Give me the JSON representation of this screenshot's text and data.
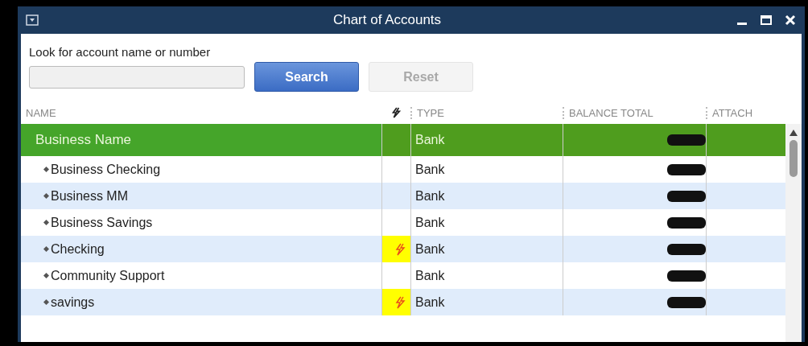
{
  "window": {
    "title": "Chart of Accounts"
  },
  "search": {
    "label": "Look for account name or number",
    "search_button": "Search",
    "reset_button": "Reset",
    "reset_disabled": true
  },
  "columns": {
    "name": "NAME",
    "type": "TYPE",
    "balance": "BALANCE TOTAL",
    "attach": "ATTACH"
  },
  "accounts": [
    {
      "name": "Business Name",
      "selected": true,
      "online": false,
      "highlighted": false,
      "type": "Bank",
      "balance_redacted": true,
      "children": [
        {
          "name": "Business Checking",
          "selected": false,
          "online": false,
          "highlighted": false,
          "type": "Bank",
          "balance_redacted": true
        },
        {
          "name": "Business MM",
          "selected": false,
          "online": false,
          "highlighted": false,
          "type": "Bank",
          "balance_redacted": true
        },
        {
          "name": "Business Savings",
          "selected": false,
          "online": false,
          "highlighted": false,
          "type": "Bank",
          "balance_redacted": true
        },
        {
          "name": "Checking",
          "selected": false,
          "online": true,
          "highlighted": true,
          "type": "Bank",
          "balance_redacted": true
        },
        {
          "name": "Community Support",
          "selected": false,
          "online": false,
          "highlighted": false,
          "type": "Bank",
          "balance_redacted": true
        },
        {
          "name": "savings",
          "selected": false,
          "online": true,
          "highlighted": true,
          "type": "Bank",
          "balance_redacted": true
        }
      ]
    }
  ]
}
